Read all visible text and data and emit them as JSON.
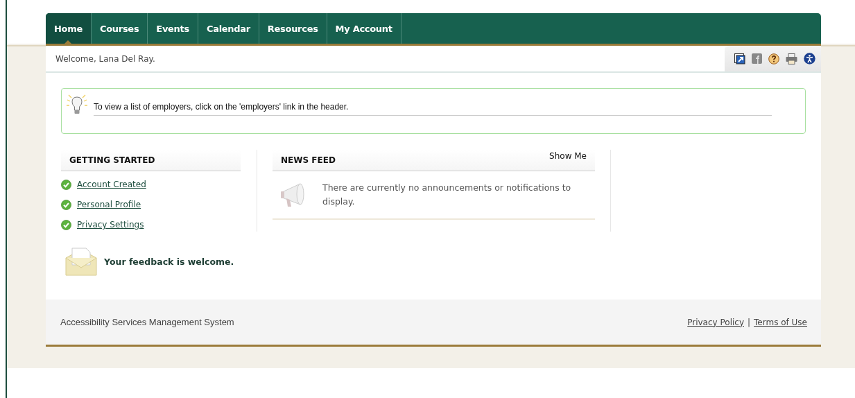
{
  "nav": {
    "tabs": [
      {
        "label": "Home",
        "selected": true
      },
      {
        "label": "Courses",
        "selected": false
      },
      {
        "label": "Events",
        "selected": false
      },
      {
        "label": "Calendar",
        "selected": false
      },
      {
        "label": "Resources",
        "selected": false
      },
      {
        "label": "My Account",
        "selected": false
      }
    ]
  },
  "welcome": "Welcome, Lana Del Ray.",
  "tip": "To view a list of employers, click on the 'employers' link in the header.",
  "getting_started": {
    "title": "GETTING STARTED",
    "items": [
      {
        "label": "Account Created",
        "checked": true
      },
      {
        "label": "Personal Profile",
        "checked": true
      },
      {
        "label": "Privacy Settings",
        "checked": true
      }
    ]
  },
  "news_feed": {
    "title": "NEWS FEED",
    "action": "Show Me",
    "message": "There are currently no announcements or notifications to display."
  },
  "feedback": "Your feedback is welcome.",
  "footer": {
    "text": "Accessibility Services Management System",
    "links": [
      "Privacy Policy",
      "Terms of Use"
    ],
    "separator": "|"
  }
}
